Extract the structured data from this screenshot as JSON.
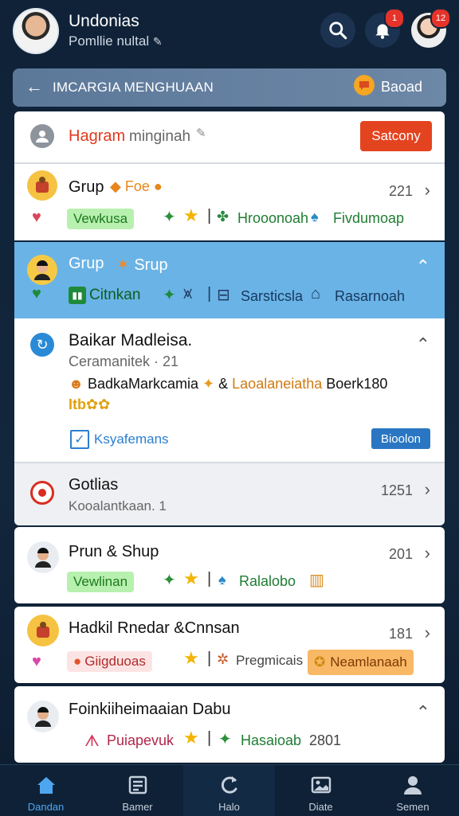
{
  "header": {
    "user_name": "Undonias",
    "user_status": "Pomllie nultal",
    "badges": {
      "notifications": "1",
      "profile": "12"
    }
  },
  "banner": {
    "title": "IMCARGIA MENGHUAAN",
    "action": "Baoad"
  },
  "search_card": {
    "title": "Hagram",
    "subtitle": "minginah",
    "button": "Satcony"
  },
  "card1": {
    "title": "Grup",
    "tag": "Foe",
    "count": "221",
    "tags": [
      "Vewkusa",
      "Hrooonoah",
      "Fivdumoap"
    ]
  },
  "card2": {
    "title": "Grup",
    "tag": "Srup",
    "tags": [
      "Citnkan",
      "Sarsticsla",
      "Rasarnoah"
    ]
  },
  "card3": {
    "title": "Baikar Madleisa.",
    "subtitle": "Ceramanitek · 21",
    "line": "BadkaMarkcamia",
    "line_orange": "Laoalaneiatha",
    "line_end": "Boerk180",
    "rating": "Itb",
    "checkbox_label": "Ksyafemans",
    "button": "Bioolon"
  },
  "card4": {
    "title": "Gotlias",
    "subtitle": "Kooalantkaan. 1",
    "count": "1251"
  },
  "card5": {
    "title": "Prun & Shup",
    "count": "201",
    "tags": [
      "Vewlinan",
      "Ralalobo"
    ]
  },
  "card6": {
    "title": "Hadkil Rnedar &Cnnsan",
    "count": "181",
    "tags": [
      "Giigduoas",
      "Pregmicais",
      "Neamlanaah"
    ]
  },
  "card7": {
    "title": "Foinkiiheimaaian Dabu",
    "tags": [
      "Puiapevuk",
      "Hasaioab"
    ],
    "count": "2801"
  },
  "nav": [
    {
      "label": "Dandan",
      "icon": "home-icon",
      "active": true
    },
    {
      "label": "Bamer",
      "icon": "list-icon"
    },
    {
      "label": "Halo",
      "icon": "refresh-icon"
    },
    {
      "label": "Diate",
      "icon": "image-icon"
    },
    {
      "label": "Semen",
      "icon": "user-icon"
    }
  ],
  "colors": {
    "accent": "#4fa6f0",
    "highlight": "#6ab3e6",
    "danger": "#e5332a",
    "brand_orange": "#f28c28"
  }
}
